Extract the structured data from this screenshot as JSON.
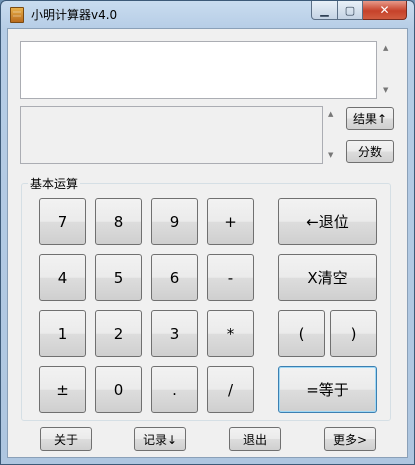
{
  "window": {
    "title": "小明计算器v4.0",
    "min_label": "▁",
    "max_label": "▢",
    "close_label": "✕"
  },
  "display": {
    "input_value": "",
    "result_value": ""
  },
  "side_buttons": {
    "result": "结果↑",
    "fraction": "分数"
  },
  "group": {
    "label": "基本运算"
  },
  "keys": {
    "k7": "7",
    "k8": "8",
    "k9": "9",
    "plus": "+",
    "k4": "4",
    "k5": "5",
    "k6": "6",
    "minus": "-",
    "k1": "1",
    "k2": "2",
    "k3": "3",
    "mul": "*",
    "neg": "±",
    "k0": "0",
    "dot": ".",
    "div": "/",
    "backspace": "←退位",
    "clear": "X清空",
    "lparen": "(",
    "rparen": ")",
    "equals": "=等于"
  },
  "bottom": {
    "about": "关于",
    "history": "记录↓",
    "exit": "退出",
    "more": "更多>"
  }
}
